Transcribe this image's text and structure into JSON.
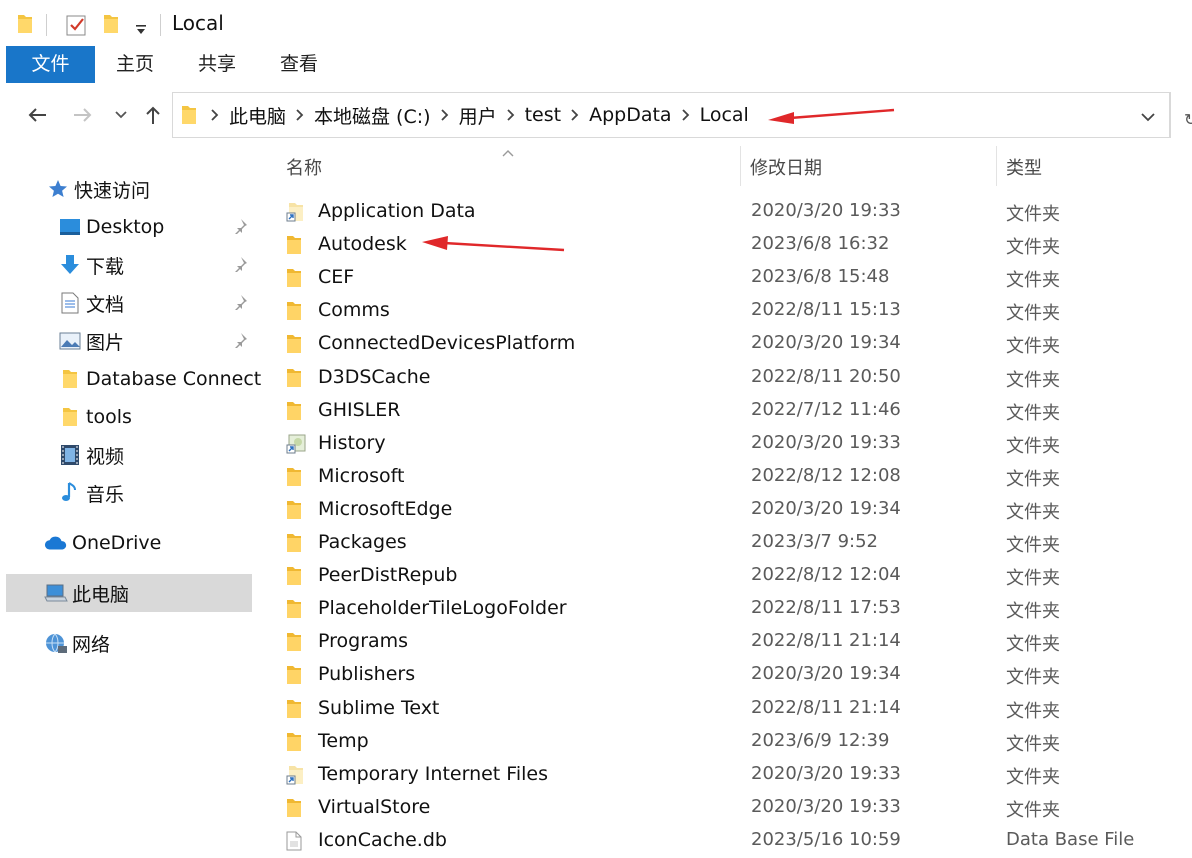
{
  "titlebar": {
    "title": "Local",
    "quick_access_icons": [
      "folder-icon",
      "properties-checkbox-icon",
      "new-folder-icon",
      "customize-dropdown-icon"
    ]
  },
  "ribbon": {
    "tabs": [
      {
        "label": "文件",
        "active": true
      },
      {
        "label": "主页"
      },
      {
        "label": "共享"
      },
      {
        "label": "查看"
      }
    ],
    "accent": "#1976c9"
  },
  "address": {
    "segments": [
      "此电脑",
      "本地磁盘 (C:)",
      "用户",
      "test",
      "AppData",
      "Local"
    ]
  },
  "sidebar": {
    "quick_access": "快速访问",
    "items": [
      {
        "label": "Desktop",
        "icon": "desktop-icon",
        "pinned": true
      },
      {
        "label": "下载",
        "icon": "download-icon",
        "pinned": true
      },
      {
        "label": "文档",
        "icon": "document-icon",
        "pinned": true
      },
      {
        "label": "图片",
        "icon": "pictures-icon",
        "pinned": true
      },
      {
        "label": "Database Connect",
        "icon": "folder-icon",
        "pinned": false
      },
      {
        "label": "tools",
        "icon": "folder-icon",
        "pinned": false
      },
      {
        "label": "视频",
        "icon": "video-icon",
        "pinned": false
      },
      {
        "label": "音乐",
        "icon": "music-icon",
        "pinned": false
      }
    ],
    "onedrive": "OneDrive",
    "this_pc": "此电脑",
    "network": "网络"
  },
  "columns": {
    "name": "名称",
    "modified": "修改日期",
    "type": "类型"
  },
  "files": [
    {
      "name": "Application Data",
      "date": "2020/3/20 19:33",
      "type": "文件夹",
      "icon": "shortcut-folder-icon"
    },
    {
      "name": "Autodesk",
      "date": "2023/6/8 16:32",
      "type": "文件夹",
      "icon": "folder-icon"
    },
    {
      "name": "CEF",
      "date": "2023/6/8 15:48",
      "type": "文件夹",
      "icon": "folder-icon"
    },
    {
      "name": "Comms",
      "date": "2022/8/11 15:13",
      "type": "文件夹",
      "icon": "folder-icon"
    },
    {
      "name": "ConnectedDevicesPlatform",
      "date": "2020/3/20 19:34",
      "type": "文件夹",
      "icon": "folder-icon"
    },
    {
      "name": "D3DSCache",
      "date": "2022/8/11 20:50",
      "type": "文件夹",
      "icon": "folder-icon"
    },
    {
      "name": "GHISLER",
      "date": "2022/7/12 11:46",
      "type": "文件夹",
      "icon": "folder-icon"
    },
    {
      "name": "History",
      "date": "2020/3/20 19:33",
      "type": "文件夹",
      "icon": "history-shortcut-icon"
    },
    {
      "name": "Microsoft",
      "date": "2022/8/12 12:08",
      "type": "文件夹",
      "icon": "folder-icon"
    },
    {
      "name": "MicrosoftEdge",
      "date": "2020/3/20 19:34",
      "type": "文件夹",
      "icon": "folder-icon"
    },
    {
      "name": "Packages",
      "date": "2023/3/7 9:52",
      "type": "文件夹",
      "icon": "folder-icon"
    },
    {
      "name": "PeerDistRepub",
      "date": "2022/8/12 12:04",
      "type": "文件夹",
      "icon": "folder-icon"
    },
    {
      "name": "PlaceholderTileLogoFolder",
      "date": "2022/8/11 17:53",
      "type": "文件夹",
      "icon": "folder-icon"
    },
    {
      "name": "Programs",
      "date": "2022/8/11 21:14",
      "type": "文件夹",
      "icon": "folder-icon"
    },
    {
      "name": "Publishers",
      "date": "2020/3/20 19:34",
      "type": "文件夹",
      "icon": "folder-icon"
    },
    {
      "name": "Sublime Text",
      "date": "2022/8/11 21:14",
      "type": "文件夹",
      "icon": "folder-icon"
    },
    {
      "name": "Temp",
      "date": "2023/6/9 12:39",
      "type": "文件夹",
      "icon": "folder-icon"
    },
    {
      "name": "Temporary Internet Files",
      "date": "2020/3/20 19:33",
      "type": "文件夹",
      "icon": "shortcut-folder-icon"
    },
    {
      "name": "VirtualStore",
      "date": "2020/3/20 19:33",
      "type": "文件夹",
      "icon": "folder-icon"
    },
    {
      "name": "IconCache.db",
      "date": "2023/5/16 10:59",
      "type": "Data Base File",
      "icon": "file-icon"
    }
  ],
  "annotation_color": "#e0282a"
}
